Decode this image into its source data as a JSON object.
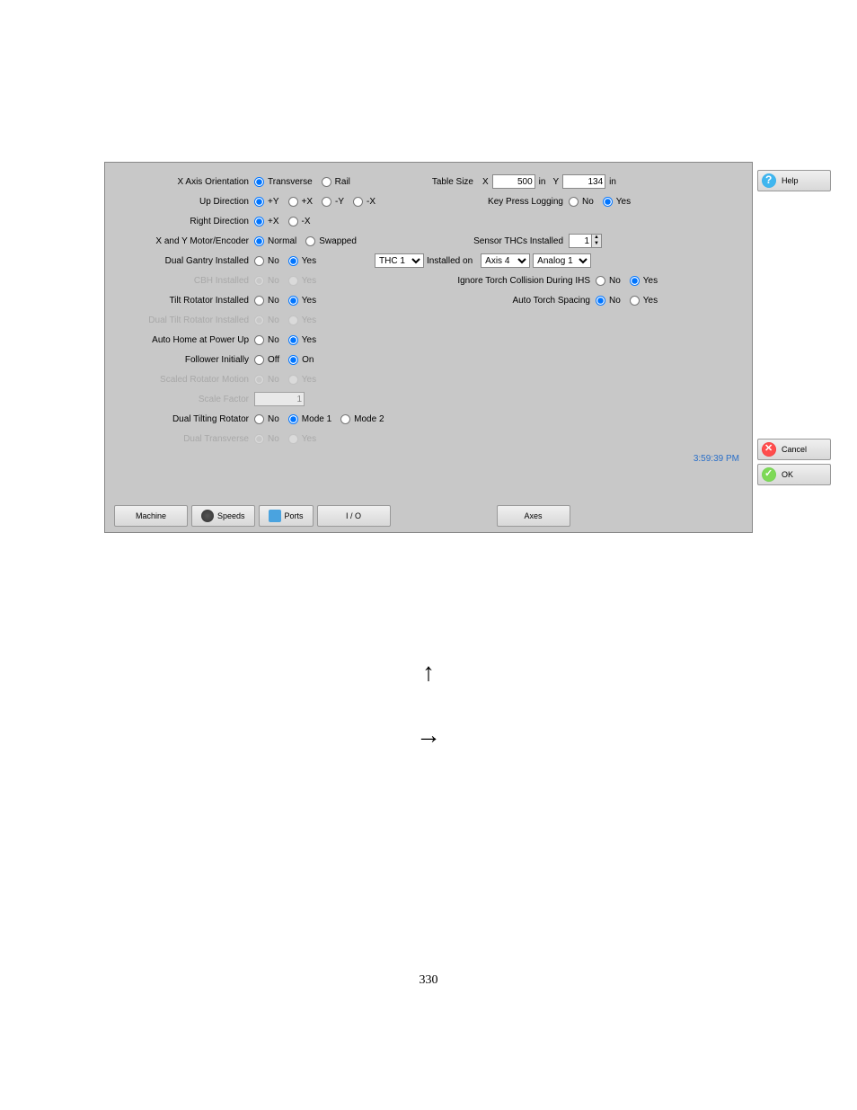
{
  "labels": {
    "x_axis_orientation": "X Axis Orientation",
    "up_direction": "Up Direction",
    "right_direction": "Right Direction",
    "x_y_motor_encoder": "X and Y Motor/Encoder",
    "dual_gantry_installed": "Dual Gantry Installed",
    "cbh_installed": "CBH Installed",
    "tilt_rotator_installed": "Tilt Rotator Installed",
    "dual_tilt_rotator_installed": "Dual Tilt Rotator Installed",
    "auto_home_power_up": "Auto Home at Power Up",
    "follower_initially": "Follower Initially",
    "scaled_rotator_motion": "Scaled Rotator Motion",
    "scale_factor": "Scale Factor",
    "dual_tilting_rotator": "Dual Tilting Rotator",
    "dual_transverse": "Dual Transverse",
    "table_size": "Table Size",
    "key_press_logging": "Key Press Logging",
    "sensor_thcs_installed": "Sensor THCs Installed",
    "installed_on": "Installed on",
    "ignore_torch_collision": "Ignore Torch Collision During IHS",
    "auto_torch_spacing": "Auto Torch Spacing"
  },
  "options": {
    "transverse": "Transverse",
    "rail": "Rail",
    "plus_y": "+Y",
    "plus_x": "+X",
    "minus_y": "-Y",
    "minus_x": "-X",
    "normal": "Normal",
    "swapped": "Swapped",
    "no": "No",
    "yes": "Yes",
    "off": "Off",
    "on": "On",
    "mode1": "Mode 1",
    "mode2": "Mode 2",
    "x": "X",
    "y": "Y",
    "in": "in"
  },
  "values": {
    "table_x": "500",
    "table_y": "134",
    "sensor_thcs": "1",
    "thc_select": "THC 1",
    "axis_select": "Axis 4",
    "analog_select": "Analog 1",
    "scale_factor": "1"
  },
  "buttons": {
    "help": "Help",
    "cancel": "Cancel",
    "ok": "OK",
    "machine": "Machine",
    "speeds": "Speeds",
    "ports": "Ports",
    "io": "I / O",
    "axes": "Axes"
  },
  "timestamp": "3:59:39 PM",
  "page_number": "330"
}
